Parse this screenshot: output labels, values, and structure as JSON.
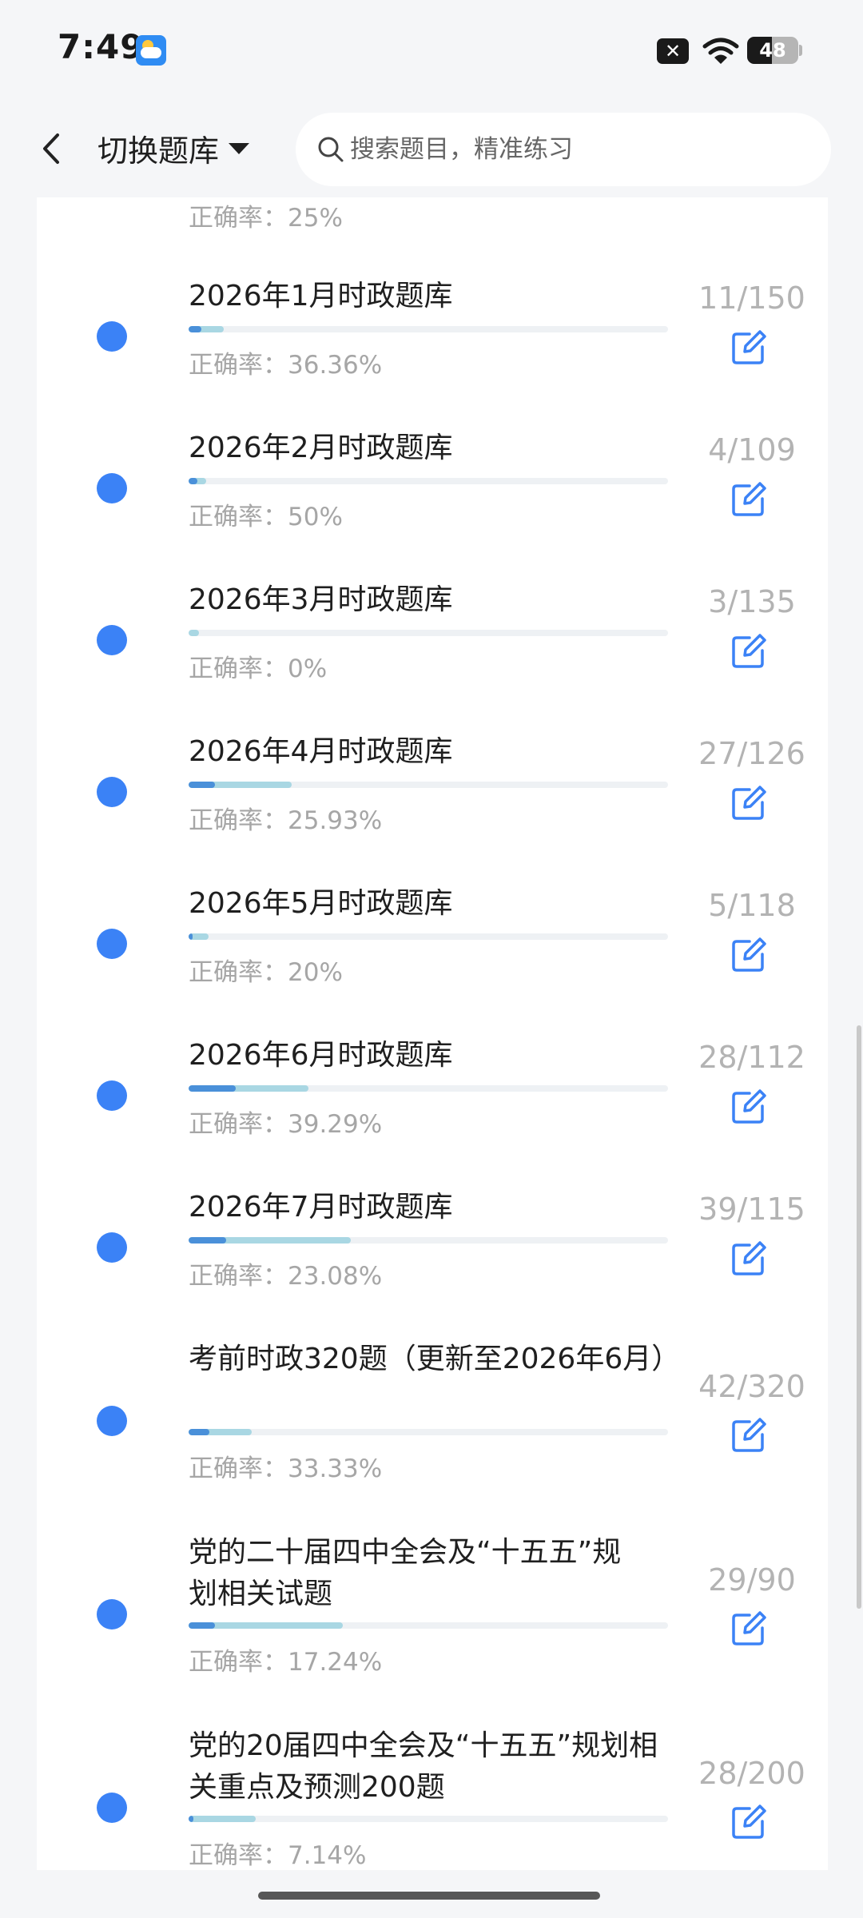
{
  "status_bar": {
    "time": "7:49",
    "battery_level": "48",
    "icons": [
      "weather-icon",
      "notification-x-icon",
      "wifi-icon",
      "battery-icon"
    ]
  },
  "header": {
    "title": "切换题库",
    "search_placeholder": "搜索题目，精准练习"
  },
  "partial_top_accuracy": "正确率：25%",
  "colors": {
    "accent": "#3b82f6",
    "progress_light": "#a9d7e3",
    "progress_dark": "#4a90d9"
  },
  "items": [
    {
      "name": "2026年1月时政题库",
      "count": "11/150",
      "accuracy": "正确率：36.36%",
      "progress": 0.0733,
      "accuracy_value": 0.3636
    },
    {
      "name": "2026年2月时政题库",
      "count": "4/109",
      "accuracy": "正确率：50%",
      "progress": 0.0367,
      "accuracy_value": 0.5
    },
    {
      "name": "2026年3月时政题库",
      "count": "3/135",
      "accuracy": "正确率：0%",
      "progress": 0.0222,
      "accuracy_value": 0
    },
    {
      "name": "2026年4月时政题库",
      "count": "27/126",
      "accuracy": "正确率：25.93%",
      "progress": 0.2143,
      "accuracy_value": 0.2593
    },
    {
      "name": "2026年5月时政题库",
      "count": "5/118",
      "accuracy": "正确率：20%",
      "progress": 0.0424,
      "accuracy_value": 0.2
    },
    {
      "name": "2026年6月时政题库",
      "count": "28/112",
      "accuracy": "正确率：39.29%",
      "progress": 0.25,
      "accuracy_value": 0.3929
    },
    {
      "name": "2026年7月时政题库",
      "count": "39/115",
      "accuracy": "正确率：23.08%",
      "progress": 0.3391,
      "accuracy_value": 0.2308
    },
    {
      "name": "考前时政320题（更新至2026年6月）",
      "count": "42/320",
      "accuracy": "正确率：33.33%",
      "progress": 0.1313,
      "accuracy_value": 0.3333
    },
    {
      "name": "党的二十届四中全会及“十五五”规划相关试题",
      "count": "29/90",
      "accuracy": "正确率：17.24%",
      "progress": 0.3222,
      "accuracy_value": 0.1724
    },
    {
      "name": "党的20届四中全会及“十五五”规划相关重点及预测200题",
      "count": "28/200",
      "accuracy": "正确率：7.14%",
      "progress": 0.14,
      "accuracy_value": 0.0714
    }
  ]
}
